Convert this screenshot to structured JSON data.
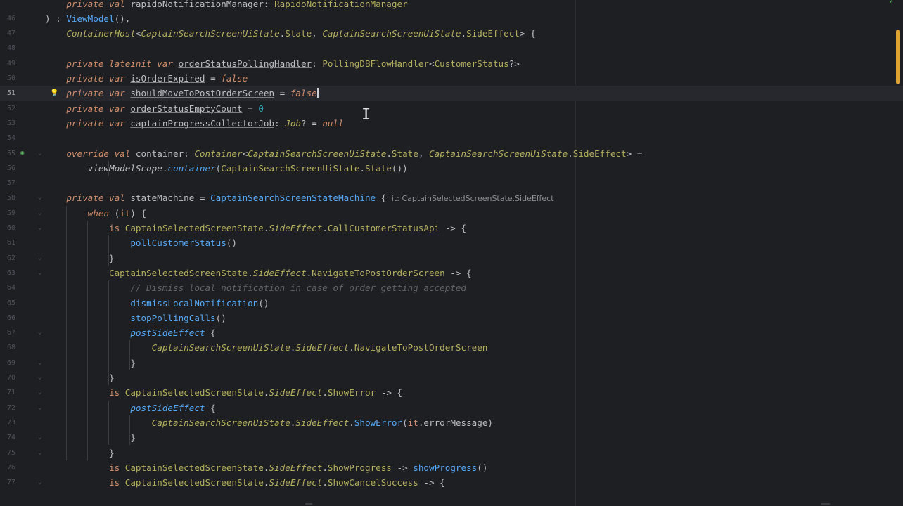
{
  "editor": {
    "lines": [
      {
        "n": "",
        "parts": [
          [
            "    "
          ],
          [
            "private val ",
            "kwi"
          ],
          [
            "rapidoNotificationManager",
            "pr"
          ],
          [
            ": "
          ],
          [
            "RapidoNotificationManager",
            "cl"
          ]
        ]
      },
      {
        "n": "46",
        "parts": [
          [
            ") : "
          ],
          [
            "ViewModel",
            "fn"
          ],
          [
            "(),"
          ]
        ]
      },
      {
        "n": "47",
        "parts": [
          [
            "    "
          ],
          [
            "ContainerHost",
            "cli"
          ],
          [
            "<"
          ],
          [
            "CaptainSearchScreenUiState",
            "cli"
          ],
          [
            "."
          ],
          [
            "State",
            "cl"
          ],
          [
            ", "
          ],
          [
            "CaptainSearchScreenUiState",
            "cli"
          ],
          [
            "."
          ],
          [
            "SideEffect",
            "cl"
          ],
          [
            "> {"
          ]
        ]
      },
      {
        "n": "48",
        "parts": []
      },
      {
        "n": "49",
        "parts": [
          [
            "    "
          ],
          [
            "private lateinit var ",
            "kwi"
          ],
          [
            "orderStatusPollingHandler",
            "id"
          ],
          [
            ": "
          ],
          [
            "PollingDBFlowHandler",
            "cl"
          ],
          [
            "<"
          ],
          [
            "CustomerStatus",
            "cl"
          ],
          [
            "?>"
          ]
        ]
      },
      {
        "n": "50",
        "parts": [
          [
            "    "
          ],
          [
            "private var ",
            "kwi"
          ],
          [
            "isOrderExpired",
            "id"
          ],
          [
            " = "
          ],
          [
            "false",
            "kwi"
          ]
        ]
      },
      {
        "n": "51",
        "parts": [
          [
            "    "
          ],
          [
            "private var ",
            "kwi"
          ],
          [
            "shouldMoveToPostOrderScreen",
            "id"
          ],
          [
            " = "
          ],
          [
            "false",
            "kwi"
          ]
        ],
        "current": true,
        "caret": true
      },
      {
        "n": "52",
        "parts": [
          [
            "    "
          ],
          [
            "private var ",
            "kwi"
          ],
          [
            "orderStatusEmptyCount",
            "id"
          ],
          [
            " = "
          ],
          [
            "0",
            "num"
          ]
        ]
      },
      {
        "n": "53",
        "parts": [
          [
            "    "
          ],
          [
            "private var ",
            "kwi"
          ],
          [
            "captainProgressCollectorJob",
            "id"
          ],
          [
            ": "
          ],
          [
            "Job",
            "cli"
          ],
          [
            "? = "
          ],
          [
            "null",
            "kwi"
          ]
        ]
      },
      {
        "n": "54",
        "parts": []
      },
      {
        "n": "55",
        "parts": [
          [
            "    "
          ],
          [
            "override val ",
            "kwi"
          ],
          [
            "container",
            "pr"
          ],
          [
            ": "
          ],
          [
            "Container",
            "cli"
          ],
          [
            "<"
          ],
          [
            "CaptainSearchScreenUiState",
            "cli"
          ],
          [
            "."
          ],
          [
            "State",
            "cl"
          ],
          [
            ", "
          ],
          [
            "CaptainSearchScreenUiState",
            "cli"
          ],
          [
            "."
          ],
          [
            "SideEffect",
            "cl"
          ],
          [
            "> ="
          ]
        ]
      },
      {
        "n": "56",
        "parts": [
          [
            "        "
          ],
          [
            "viewModelScope",
            "it"
          ],
          [
            "."
          ],
          [
            "container",
            "fni"
          ],
          [
            "("
          ],
          [
            "CaptainSearchScreenUiState",
            "cl"
          ],
          [
            "."
          ],
          [
            "State",
            "cl"
          ],
          [
            "())"
          ]
        ]
      },
      {
        "n": "57",
        "parts": []
      },
      {
        "n": "58",
        "parts": [
          [
            "    "
          ],
          [
            "private val ",
            "kwi"
          ],
          [
            "stateMachine",
            "pr"
          ],
          [
            " = "
          ],
          [
            "CaptainSearchScreenStateMachine",
            "fn"
          ],
          [
            " { "
          ]
        ],
        "hint": "it: CaptainSelectedScreenState.SideEffect"
      },
      {
        "n": "59",
        "parts": [
          [
            "        "
          ],
          [
            "when ",
            "kwi"
          ],
          [
            "("
          ],
          [
            "it",
            "kw"
          ],
          [
            ") {"
          ]
        ]
      },
      {
        "n": "60",
        "parts": [
          [
            "            "
          ],
          [
            "is ",
            "kw"
          ],
          [
            "CaptainSelectedScreenState",
            "cl"
          ],
          [
            "."
          ],
          [
            "SideEffect",
            "cli"
          ],
          [
            "."
          ],
          [
            "CallCustomerStatusApi",
            "cl"
          ],
          [
            " -> {"
          ]
        ]
      },
      {
        "n": "61",
        "parts": [
          [
            "                "
          ],
          [
            "pollCustomerStatus",
            "fn"
          ],
          [
            "()"
          ]
        ]
      },
      {
        "n": "62",
        "parts": [
          [
            "            }"
          ]
        ]
      },
      {
        "n": "63",
        "parts": [
          [
            "            "
          ],
          [
            "CaptainSelectedScreenState",
            "cl"
          ],
          [
            "."
          ],
          [
            "SideEffect",
            "cli"
          ],
          [
            "."
          ],
          [
            "NavigateToPostOrderScreen",
            "cl"
          ],
          [
            " -> {"
          ]
        ]
      },
      {
        "n": "64",
        "parts": [
          [
            "                "
          ],
          [
            "// Dismiss local notification in case of order getting accepted",
            "cm"
          ]
        ]
      },
      {
        "n": "65",
        "parts": [
          [
            "                "
          ],
          [
            "dismissLocalNotification",
            "fn"
          ],
          [
            "()"
          ]
        ]
      },
      {
        "n": "66",
        "parts": [
          [
            "                "
          ],
          [
            "stopPollingCalls",
            "fn"
          ],
          [
            "()"
          ]
        ]
      },
      {
        "n": "67",
        "parts": [
          [
            "                "
          ],
          [
            "postSideEffect",
            "fni"
          ],
          [
            " {"
          ]
        ]
      },
      {
        "n": "68",
        "parts": [
          [
            "                    "
          ],
          [
            "CaptainSearchScreenUiState",
            "cli"
          ],
          [
            "."
          ],
          [
            "SideEffect",
            "cli"
          ],
          [
            "."
          ],
          [
            "NavigateToPostOrderScreen",
            "cl"
          ]
        ]
      },
      {
        "n": "69",
        "parts": [
          [
            "                }"
          ]
        ]
      },
      {
        "n": "70",
        "parts": [
          [
            "            }"
          ]
        ]
      },
      {
        "n": "71",
        "parts": [
          [
            "            "
          ],
          [
            "is ",
            "kw"
          ],
          [
            "CaptainSelectedScreenState",
            "cl"
          ],
          [
            "."
          ],
          [
            "SideEffect",
            "cli"
          ],
          [
            "."
          ],
          [
            "ShowError",
            "cl"
          ],
          [
            " -> {"
          ]
        ]
      },
      {
        "n": "72",
        "parts": [
          [
            "                "
          ],
          [
            "postSideEffect",
            "fni"
          ],
          [
            " {"
          ]
        ]
      },
      {
        "n": "73",
        "parts": [
          [
            "                    "
          ],
          [
            "CaptainSearchScreenUiState",
            "cli"
          ],
          [
            "."
          ],
          [
            "SideEffect",
            "cli"
          ],
          [
            "."
          ],
          [
            "ShowError",
            "fn"
          ],
          [
            "("
          ],
          [
            "it",
            "kw"
          ],
          [
            "."
          ],
          [
            "errorMessage",
            "pr"
          ],
          [
            ")"
          ]
        ]
      },
      {
        "n": "74",
        "parts": [
          [
            "                }"
          ]
        ]
      },
      {
        "n": "75",
        "parts": [
          [
            "            }"
          ]
        ]
      },
      {
        "n": "76",
        "parts": [
          [
            "            "
          ],
          [
            "is ",
            "kw"
          ],
          [
            "CaptainSelectedScreenState",
            "cl"
          ],
          [
            "."
          ],
          [
            "SideEffect",
            "cli"
          ],
          [
            "."
          ],
          [
            "ShowProgress",
            "cl"
          ],
          [
            " -> "
          ],
          [
            "showProgress",
            "fn"
          ],
          [
            "()"
          ]
        ]
      },
      {
        "n": "77",
        "parts": [
          [
            "            "
          ],
          [
            "is ",
            "kw"
          ],
          [
            "CaptainSelectedScreenState",
            "cl"
          ],
          [
            "."
          ],
          [
            "SideEffect",
            "cli"
          ],
          [
            "."
          ],
          [
            "ShowCancelSuccess",
            "cl"
          ],
          [
            " -> {"
          ]
        ]
      }
    ]
  },
  "colors": {
    "background": "#1e1f22",
    "keyword": "#cf8e6d",
    "function": "#56a8f5",
    "class": "#b3ae60",
    "comment": "#5f6369",
    "number": "#2aacb8",
    "scrollbar": "#e0a435"
  },
  "icons": {
    "bulb": "lightbulb-icon",
    "override": "override-marker-icon",
    "inspection": "check-icon"
  }
}
